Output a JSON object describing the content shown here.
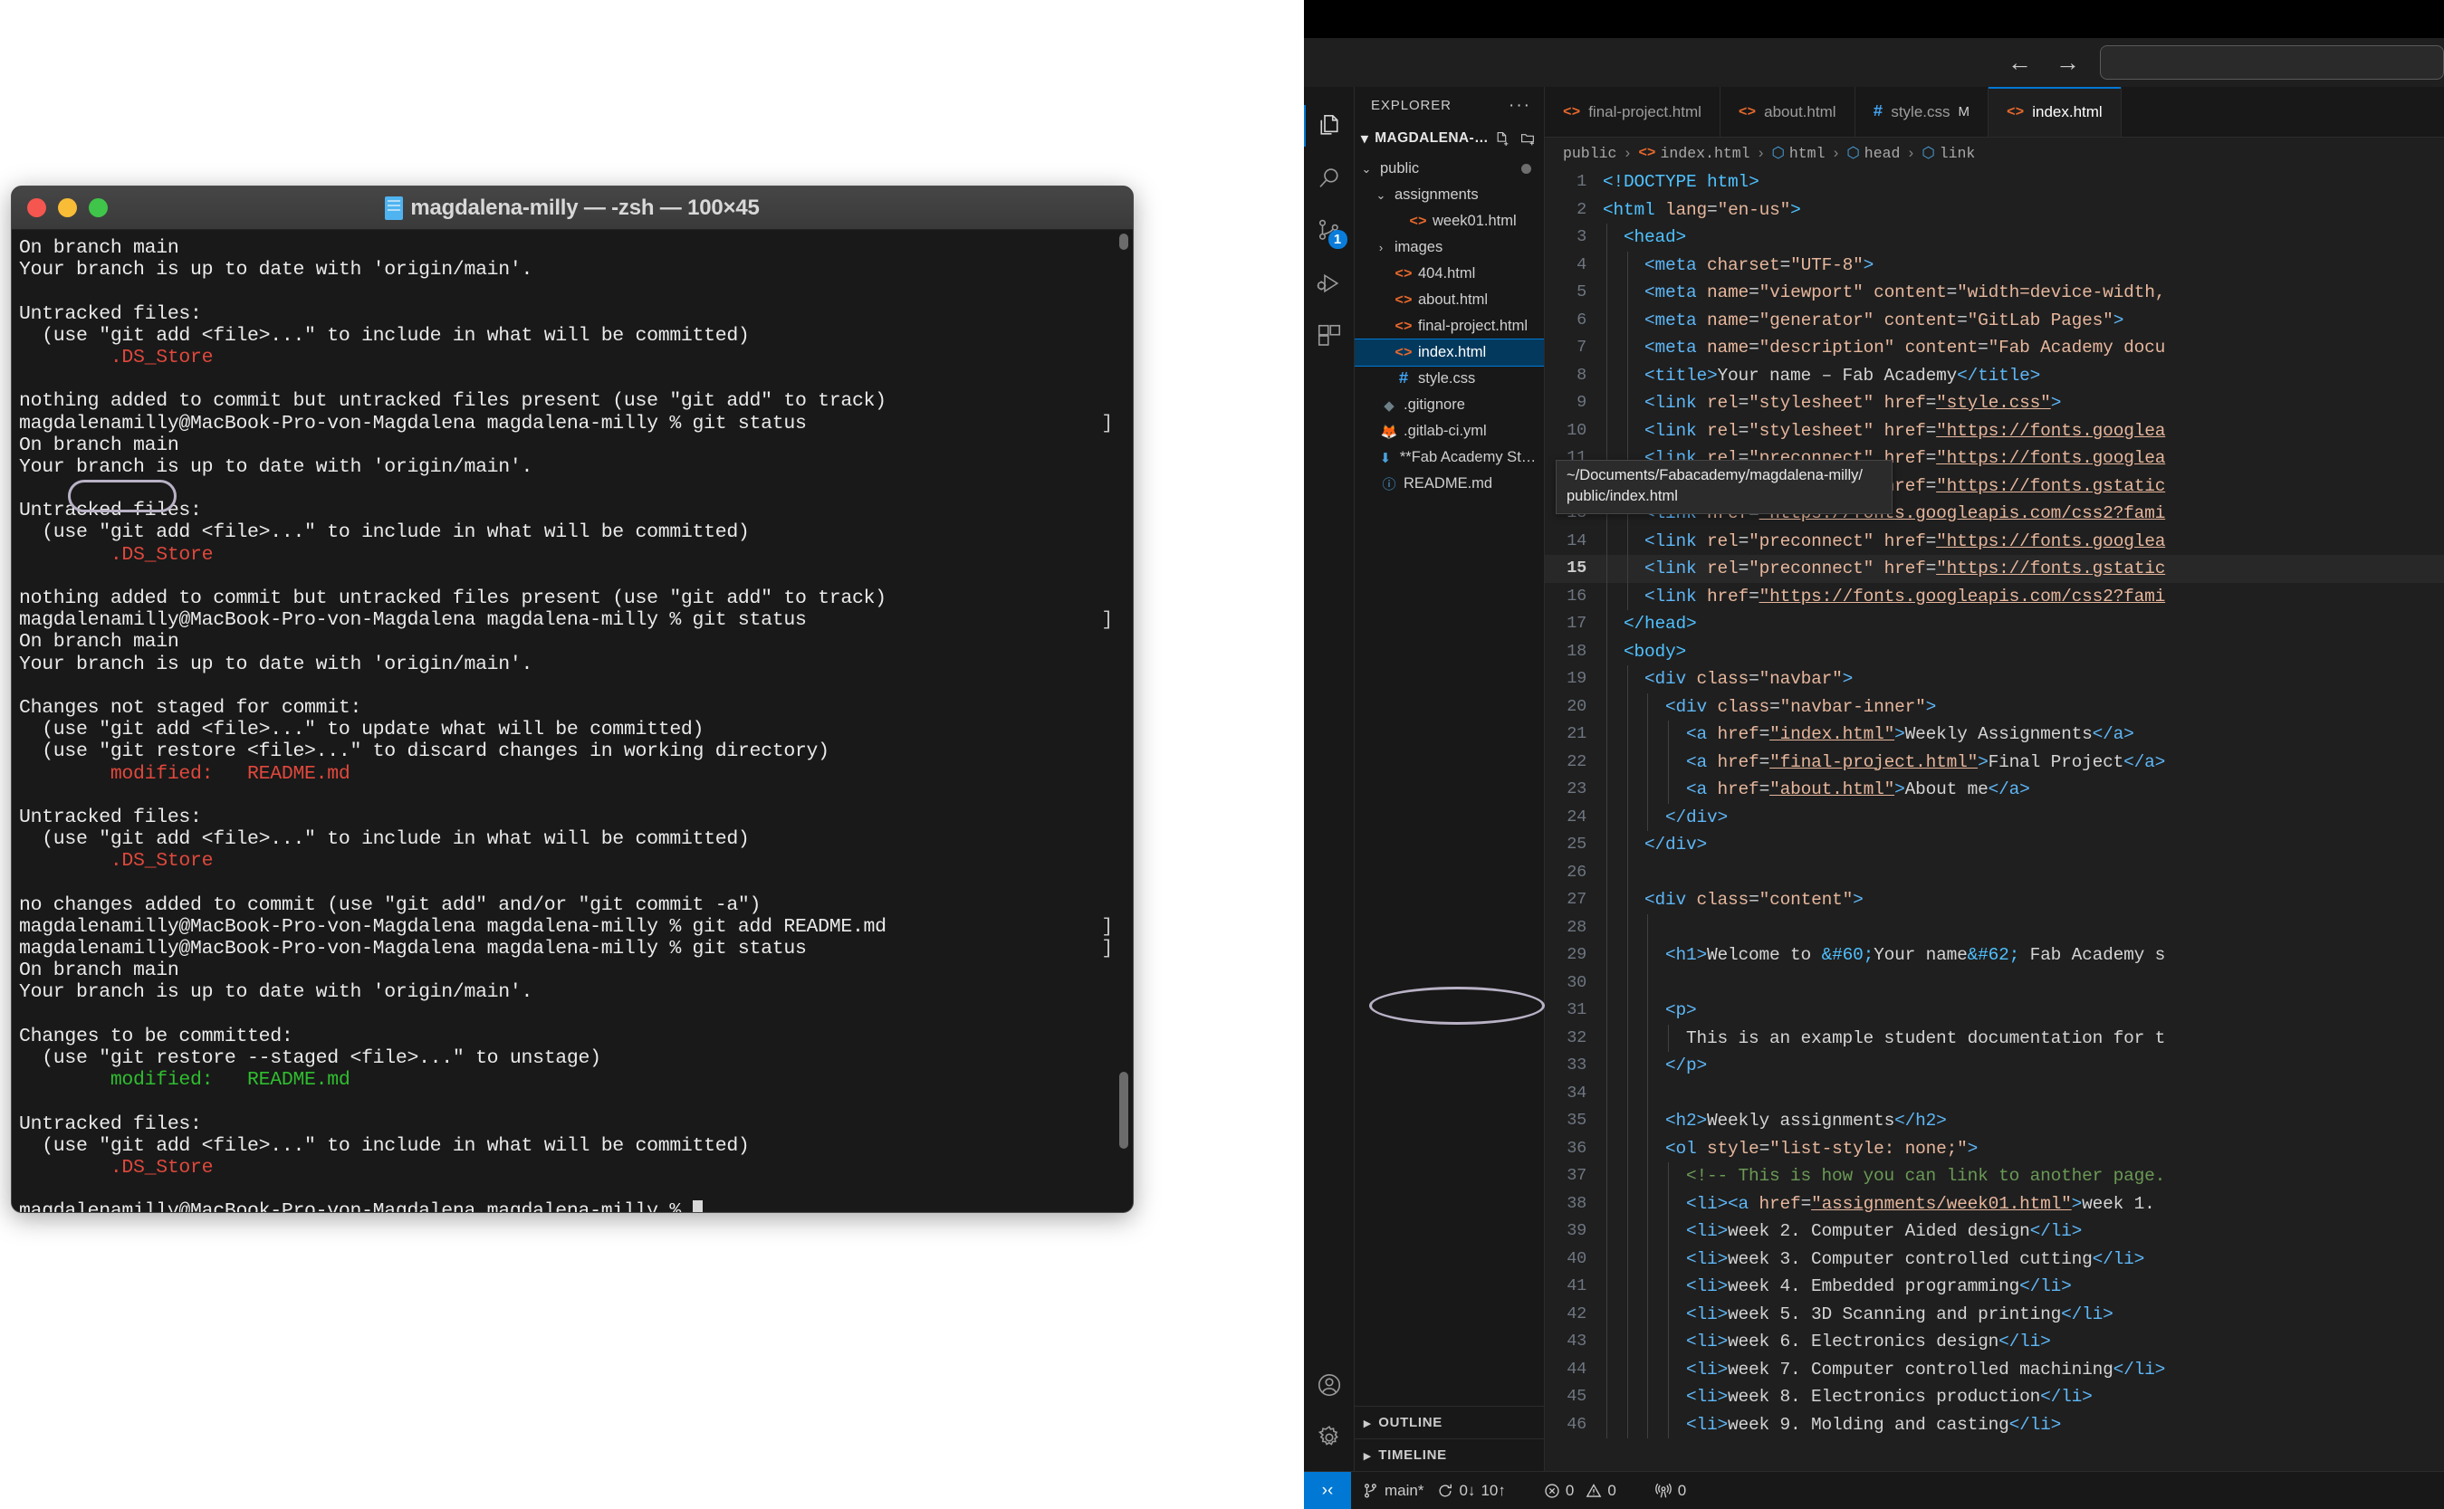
{
  "terminal": {
    "title": "magdalena-milly — -zsh — 100×45",
    "icon": "terminal-document-icon",
    "traffic_lights": [
      "close",
      "minimize",
      "zoom"
    ],
    "prompt": "magdalenamilly@MacBook-Pro-von-Magdalena magdalena-milly % ",
    "lines": [
      {
        "text": "On branch main"
      },
      {
        "text": "Your branch is up to date with 'origin/main'."
      },
      {
        "text": ""
      },
      {
        "text": "Untracked files:"
      },
      {
        "text": "  (use \"git add <file>...\" to include in what will be committed)"
      },
      {
        "text": "\t.DS_Store",
        "color": "red"
      },
      {
        "text": ""
      },
      {
        "text": "nothing added to commit but untracked files present (use \"git add\" to track)"
      },
      {
        "text": "magdalenamilly@MacBook-Pro-von-Magdalena magdalena-milly % git status",
        "bracket": true
      },
      {
        "text": "On branch main"
      },
      {
        "text": "Your branch is up to date with 'origin/main'."
      },
      {
        "text": ""
      },
      {
        "text": "Untracked files:"
      },
      {
        "text": "  (use \"git add <file>...\" to include in what will be committed)"
      },
      {
        "text": "\t.DS_Store",
        "color": "red"
      },
      {
        "text": ""
      },
      {
        "text": "nothing added to commit but untracked files present (use \"git add\" to track)"
      },
      {
        "text": "magdalenamilly@MacBook-Pro-von-Magdalena magdalena-milly % git status",
        "bracket": true
      },
      {
        "text": "On branch main"
      },
      {
        "text": "Your branch is up to date with 'origin/main'."
      },
      {
        "text": ""
      },
      {
        "text": "Changes not staged for commit:"
      },
      {
        "text": "  (use \"git add <file>...\" to update what will be committed)"
      },
      {
        "text": "  (use \"git restore <file>...\" to discard changes in working directory)"
      },
      {
        "text": "\tmodified:   README.md",
        "color": "red"
      },
      {
        "text": ""
      },
      {
        "text": "Untracked files:"
      },
      {
        "text": "  (use \"git add <file>...\" to include in what will be committed)"
      },
      {
        "text": "\t.DS_Store",
        "color": "red"
      },
      {
        "text": ""
      },
      {
        "text": "no changes added to commit (use \"git add\" and/or \"git commit -a\")"
      },
      {
        "text": "magdalenamilly@MacBook-Pro-von-Magdalena magdalena-milly % git add README.md",
        "bracket": true
      },
      {
        "text": "magdalenamilly@MacBook-Pro-von-Magdalena magdalena-milly % git status",
        "bracket": true
      },
      {
        "text": "On branch main"
      },
      {
        "text": "Your branch is up to date with 'origin/main'."
      },
      {
        "text": ""
      },
      {
        "text": "Changes to be committed:"
      },
      {
        "text": "  (use \"git restore --staged <file>...\" to unstage)"
      },
      {
        "text": "\tmodified:   README.md",
        "color": "green"
      },
      {
        "text": ""
      },
      {
        "text": "Untracked files:"
      },
      {
        "text": "  (use \"git add <file>...\" to include in what will be committed)"
      },
      {
        "text": "\t.DS_Store",
        "color": "red"
      },
      {
        "text": ""
      },
      {
        "text": "magdalenamilly@MacBook-Pro-von-Magdalena magdalena-milly % ",
        "cursor": true
      }
    ]
  },
  "vscode": {
    "titlebar": {
      "back_icon": "arrow-left-icon",
      "forward_icon": "arrow-right-icon",
      "quick_input_placeholder": ""
    },
    "activitybar": {
      "items": [
        {
          "name": "explorer",
          "icon": "files-icon",
          "active": true,
          "badge": null
        },
        {
          "name": "search",
          "icon": "search-icon",
          "active": false,
          "badge": null
        },
        {
          "name": "source-control",
          "icon": "source-control-icon",
          "active": false,
          "badge": "1"
        },
        {
          "name": "run-and-debug",
          "icon": "run-debug-icon",
          "active": false,
          "badge": null
        },
        {
          "name": "extensions",
          "icon": "extensions-icon",
          "active": false,
          "badge": null
        }
      ],
      "bottom": [
        {
          "name": "accounts",
          "icon": "account-icon"
        },
        {
          "name": "manage",
          "icon": "gear-icon"
        }
      ]
    },
    "sidebar": {
      "title": "EXPLORER",
      "more_actions": "···",
      "root_label": "MAGDALENA-…",
      "root_actions": [
        "new-file-icon",
        "new-folder-icon",
        "refresh-icon",
        "collapse-all-icon"
      ],
      "tree": [
        {
          "label": "public",
          "indent": 1,
          "type": "folder",
          "expanded": true,
          "icon": "chevron-down-icon",
          "modified_dot": true
        },
        {
          "label": "assignments",
          "indent": 2,
          "type": "folder",
          "expanded": true,
          "icon": "chevron-down-icon"
        },
        {
          "label": "week01.html",
          "indent": 3,
          "type": "html",
          "icon": "html-icon"
        },
        {
          "label": "images",
          "indent": 2,
          "type": "folder",
          "expanded": false,
          "icon": "chevron-right-icon"
        },
        {
          "label": "404.html",
          "indent": 2,
          "type": "html",
          "icon": "html-icon"
        },
        {
          "label": "about.html",
          "indent": 2,
          "type": "html",
          "icon": "html-icon"
        },
        {
          "label": "final-project.html",
          "indent": 2,
          "type": "html",
          "icon": "html-icon"
        },
        {
          "label": "index.html",
          "indent": 2,
          "type": "html",
          "icon": "html-icon",
          "selected": true
        },
        {
          "label": "style.css",
          "indent": 2,
          "type": "css",
          "icon": "css-icon"
        },
        {
          "label": ".gitignore",
          "indent": 1,
          "type": "git",
          "icon": "git-icon"
        },
        {
          "label": ".gitlab-ci.yml",
          "indent": 1,
          "type": "yml",
          "icon": "gitlab-fox-icon"
        },
        {
          "label": "**Fab Academy Student A…",
          "indent": 1,
          "type": "file",
          "icon": "download-icon"
        },
        {
          "label": "README.md",
          "indent": 1,
          "type": "md",
          "icon": "info-icon"
        }
      ],
      "sections": [
        {
          "label": "OUTLINE",
          "expanded": false,
          "icon": "chevron-right-icon"
        },
        {
          "label": "TIMELINE",
          "expanded": false,
          "icon": "chevron-right-icon"
        }
      ]
    },
    "tabs": [
      {
        "label": "final-project.html",
        "icon": "html-icon",
        "active": false,
        "badge": ""
      },
      {
        "label": "about.html",
        "icon": "html-icon",
        "active": false,
        "badge": ""
      },
      {
        "label": "style.css",
        "icon": "css-icon",
        "active": false,
        "badge": "M"
      },
      {
        "label": "index.html",
        "icon": "html-icon",
        "active": true,
        "badge": ""
      }
    ],
    "breadcrumb": [
      "public",
      "index.html",
      "html",
      "head",
      "link"
    ],
    "tooltip": "~/Documents/Fabacademy/magdalena-milly/\npublic/index.html",
    "active_line": 15,
    "code": [
      {
        "n": 1,
        "indent": 0,
        "html": "<span class='k-tag2'>&lt;!DOCTYPE</span> <span class='k-tag2'>html</span><span class='k-tag2'>&gt;</span>"
      },
      {
        "n": 2,
        "indent": 0,
        "html": "<span class='k-tag2'>&lt;html</span> <span class='k-attr'>lang</span>=<span class='k-str'>\"en-us\"</span><span class='k-tag2'>&gt;</span>"
      },
      {
        "n": 3,
        "indent": 1,
        "html": "<span class='k-tag2'>&lt;head&gt;</span>"
      },
      {
        "n": 4,
        "indent": 2,
        "html": "<span class='k-tag'>&lt;meta</span> <span class='k-attr'>charset</span>=<span class='k-str'>\"UTF-8\"</span><span class='k-tag'>&gt;</span>"
      },
      {
        "n": 5,
        "indent": 2,
        "html": "<span class='k-tag'>&lt;meta</span> <span class='k-attr'>name</span>=<span class='k-str'>\"viewport\"</span> <span class='k-attr'>content</span>=<span class='k-str'>\"width=device-width,</span>"
      },
      {
        "n": 6,
        "indent": 2,
        "html": "<span class='k-tag'>&lt;meta</span> <span class='k-attr'>name</span>=<span class='k-str'>\"generator\"</span> <span class='k-attr'>content</span>=<span class='k-str'>\"GitLab Pages\"</span><span class='k-tag'>&gt;</span>"
      },
      {
        "n": 7,
        "indent": 2,
        "html": "<span class='k-tag'>&lt;meta</span> <span class='k-attr'>name</span>=<span class='k-str'>\"description\"</span> <span class='k-attr'>content</span>=<span class='k-str'>\"Fab Academy docu</span>"
      },
      {
        "n": 8,
        "indent": 2,
        "html": "<span class='k-tag'>&lt;title&gt;</span><span class='k-txt'>Your name – Fab Academy</span><span class='k-tag'>&lt;/title&gt;</span>"
      },
      {
        "n": 9,
        "indent": 2,
        "html": "<span class='k-tag'>&lt;link</span> <span class='k-attr'>rel</span>=<span class='k-str'>\"stylesheet\"</span> <span class='k-attr'>href</span>=<span class='k-link'>\"style.css\"</span><span class='k-tag'>&gt;</span>"
      },
      {
        "n": 10,
        "indent": 2,
        "html": "<span class='k-tag'>&lt;link</span> <span class='k-attr'>rel</span>=<span class='k-str'>\"stylesheet\"</span> <span class='k-attr'>href</span>=<span class='k-link'>\"https://fonts.googlea</span>"
      },
      {
        "n": 11,
        "indent": 2,
        "html": "<span class='k-tag'>&lt;link</span> <span class='k-attr'>rel</span>=<span class='k-str'>\"preconnect\"</span> <span class='k-attr'>href</span>=<span class='k-link'>\"https://fonts.googlea</span>"
      },
      {
        "n": 12,
        "indent": 2,
        "html": "<span class='k-tag'>&lt;link</span> <span class='k-attr'>rel</span>=<span class='k-str'>\"preconnect\"</span> <span class='k-attr'>href</span>=<span class='k-link'>\"https://fonts.gstatic</span>"
      },
      {
        "n": 13,
        "indent": 2,
        "html": "<span class='k-tag'>&lt;link</span> <span class='k-attr'>href</span>=<span class='k-link'>\"https://fonts.googleapis.com/css2?fami</span>"
      },
      {
        "n": 14,
        "indent": 2,
        "html": "<span class='k-tag'>&lt;link</span> <span class='k-attr'>rel</span>=<span class='k-str'>\"preconnect\"</span> <span class='k-attr'>href</span>=<span class='k-link'>\"https://fonts.googlea</span>"
      },
      {
        "n": 15,
        "indent": 2,
        "html": "<span class='k-tag'>&lt;link</span> <span class='k-attr'>rel</span>=<span class='k-str'>\"preconnect\"</span> <span class='k-attr'>href</span>=<span class='k-link'>\"https://fonts.gstatic</span>"
      },
      {
        "n": 16,
        "indent": 2,
        "html": "<span class='k-tag'>&lt;link</span> <span class='k-attr'>href</span>=<span class='k-link'>\"https://fonts.googleapis.com/css2?fami</span>"
      },
      {
        "n": 17,
        "indent": 1,
        "html": "<span class='k-tag2'>&lt;/head&gt;</span>"
      },
      {
        "n": 18,
        "indent": 1,
        "html": "<span class='k-tag2'>&lt;body&gt;</span>"
      },
      {
        "n": 19,
        "indent": 2,
        "html": "<span class='k-tag'>&lt;div</span> <span class='k-attr'>class</span>=<span class='k-str'>\"navbar\"</span><span class='k-tag'>&gt;</span>"
      },
      {
        "n": 20,
        "indent": 3,
        "html": "<span class='k-tag'>&lt;div</span> <span class='k-attr'>class</span>=<span class='k-str'>\"navbar-inner\"</span><span class='k-tag'>&gt;</span>"
      },
      {
        "n": 21,
        "indent": 4,
        "html": "<span class='k-tag'>&lt;a</span> <span class='k-attr'>href</span>=<span class='k-link'>\"index.html\"</span><span class='k-tag'>&gt;</span><span class='k-txt'>Weekly Assignments</span><span class='k-tag'>&lt;/a&gt;</span>"
      },
      {
        "n": 22,
        "indent": 4,
        "html": "<span class='k-tag'>&lt;a</span> <span class='k-attr'>href</span>=<span class='k-link'>\"final-project.html\"</span><span class='k-tag'>&gt;</span><span class='k-txt'>Final Project</span><span class='k-tag'>&lt;/a&gt;</span>"
      },
      {
        "n": 23,
        "indent": 4,
        "html": "<span class='k-tag'>&lt;a</span> <span class='k-attr'>href</span>=<span class='k-link'>\"about.html\"</span><span class='k-tag'>&gt;</span><span class='k-txt'>About me</span><span class='k-tag'>&lt;/a&gt;</span>"
      },
      {
        "n": 24,
        "indent": 3,
        "html": "<span class='k-tag'>&lt;/div&gt;</span>"
      },
      {
        "n": 25,
        "indent": 2,
        "html": "<span class='k-tag'>&lt;/div&gt;</span>"
      },
      {
        "n": 26,
        "indent": 2,
        "html": ""
      },
      {
        "n": 27,
        "indent": 2,
        "html": "<span class='k-tag'>&lt;div</span> <span class='k-attr'>class</span>=<span class='k-str'>\"content\"</span><span class='k-tag'>&gt;</span>"
      },
      {
        "n": 28,
        "indent": 3,
        "html": ""
      },
      {
        "n": 29,
        "indent": 3,
        "html": "<span class='k-tag'>&lt;h1&gt;</span><span class='k-txt'>Welcome to </span><span class='k-ent'>&amp;#60;</span><span class='k-txt'>Your name</span><span class='k-ent'>&amp;#62;</span><span class='k-txt'> Fab Academy s</span>"
      },
      {
        "n": 30,
        "indent": 3,
        "html": ""
      },
      {
        "n": 31,
        "indent": 3,
        "html": "<span class='k-tag'>&lt;p&gt;</span>"
      },
      {
        "n": 32,
        "indent": 4,
        "html": "<span class='k-txt'>This is an example student documentation for t</span>"
      },
      {
        "n": 33,
        "indent": 3,
        "html": "<span class='k-tag'>&lt;/p&gt;</span>"
      },
      {
        "n": 34,
        "indent": 3,
        "html": ""
      },
      {
        "n": 35,
        "indent": 3,
        "html": "<span class='k-tag'>&lt;h2&gt;</span><span class='k-txt'>Weekly assignments</span><span class='k-tag'>&lt;/h2&gt;</span>"
      },
      {
        "n": 36,
        "indent": 3,
        "html": "<span class='k-tag'>&lt;ol</span> <span class='k-attr'>style</span>=<span class='k-str'>\"list-style: none;\"</span><span class='k-tag'>&gt;</span>"
      },
      {
        "n": 37,
        "indent": 4,
        "html": "<span class='k-com'>&lt;!-- This is how you can link to another page.</span>"
      },
      {
        "n": 38,
        "indent": 4,
        "html": "<span class='k-tag'>&lt;li&gt;&lt;a</span> <span class='k-attr'>href</span>=<span class='k-link'>\"assignments/week01.html\"</span><span class='k-tag'>&gt;</span><span class='k-txt'>week 1.</span>"
      },
      {
        "n": 39,
        "indent": 4,
        "html": "<span class='k-tag'>&lt;li&gt;</span><span class='k-txt'>week 2. Computer Aided design</span><span class='k-tag'>&lt;/li&gt;</span>"
      },
      {
        "n": 40,
        "indent": 4,
        "html": "<span class='k-tag'>&lt;li&gt;</span><span class='k-txt'>week 3. Computer controlled cutting</span><span class='k-tag'>&lt;/li&gt;</span>"
      },
      {
        "n": 41,
        "indent": 4,
        "html": "<span class='k-tag'>&lt;li&gt;</span><span class='k-txt'>week 4. Embedded programming</span><span class='k-tag'>&lt;/li&gt;</span>"
      },
      {
        "n": 42,
        "indent": 4,
        "html": "<span class='k-tag'>&lt;li&gt;</span><span class='k-txt'>week 5. 3D Scanning and printing</span><span class='k-tag'>&lt;/li&gt;</span>"
      },
      {
        "n": 43,
        "indent": 4,
        "html": "<span class='k-tag'>&lt;li&gt;</span><span class='k-txt'>week 6. Electronics design</span><span class='k-tag'>&lt;/li&gt;</span>"
      },
      {
        "n": 44,
        "indent": 4,
        "html": "<span class='k-tag'>&lt;li&gt;</span><span class='k-txt'>week 7. Computer controlled machining</span><span class='k-tag'>&lt;/li&gt;</span>"
      },
      {
        "n": 45,
        "indent": 4,
        "html": "<span class='k-tag'>&lt;li&gt;</span><span class='k-txt'>week 8. Electronics production</span><span class='k-tag'>&lt;/li&gt;</span>"
      },
      {
        "n": 46,
        "indent": 4,
        "html": "<span class='k-tag'>&lt;li&gt;</span><span class='k-txt'>week 9. Molding and casting</span><span class='k-tag'>&lt;/li&gt;</span>"
      }
    ],
    "statusbar": {
      "remote_icon": "remote-window-icon",
      "branch_icon": "source-control-icon",
      "branch": "main*",
      "sync_icon": "sync-icon",
      "sync_down": "0↓",
      "sync_up": "10↑",
      "error_icon": "error-icon",
      "errors": "0",
      "warning_icon": "warning-icon",
      "warnings": "0",
      "radio_icon": "radio-tower-icon",
      "ports": "0"
    }
  },
  "annotations": [
    {
      "name": "ds-store-highlight",
      "shape": "rounded-rect"
    },
    {
      "name": "gitignore-highlight",
      "shape": "ellipse"
    }
  ],
  "colors": {
    "accent": "#0078d4",
    "selection": "#04395e",
    "git_untracked": "#e0483c",
    "git_staged": "#2fbd2f",
    "html_icon": "#e8692c",
    "css_icon": "#42a5f5",
    "annotation": "#b9b2c6"
  }
}
